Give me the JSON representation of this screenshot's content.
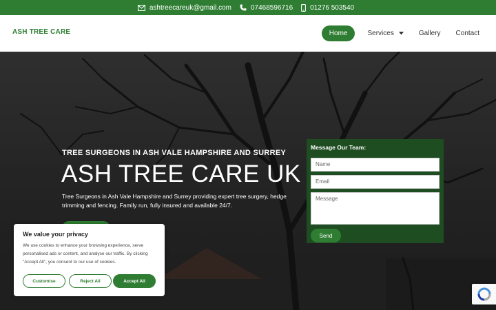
{
  "topbar": {
    "email": "ashtreecareuk@gmail.com",
    "phone1": "07468596716",
    "phone2": "01276 503540"
  },
  "header": {
    "logo": "ASH TREE CARE",
    "nav": {
      "home": "Home",
      "services": "Services",
      "gallery": "Gallery",
      "contact": "Contact"
    }
  },
  "hero": {
    "subtitle": "TREE SURGEONS IN ASH VALE HAMPSHIRE AND SURREY",
    "title": "ASH TREE CARE UK",
    "description": "Tree Surgeons in Ash Vale Hampshire and Surrey providing expert tree surgery, hedge trimming and fencing. Family run, fully insured and available 24/7."
  },
  "form": {
    "label": "Message Our Team:",
    "name_placeholder": "Name",
    "email_placeholder": "Email",
    "message_placeholder": "Message",
    "send": "Send"
  },
  "cookie": {
    "title": "We value your privacy",
    "text": "We use cookies to enhance your browsing experience, serve personalised ads or content, and analyse our traffic. By clicking \"Accept All\", you consent to our use of cookies.",
    "customise": "Customise",
    "reject": "Reject All",
    "accept": "Accept All"
  },
  "colors": {
    "brand_green": "#2e7d32",
    "form_green": "#1f4d22"
  },
  "icons": [
    "envelope-icon",
    "phone-icon",
    "mobile-icon",
    "chevron-down-icon",
    "recaptcha-icon"
  ]
}
